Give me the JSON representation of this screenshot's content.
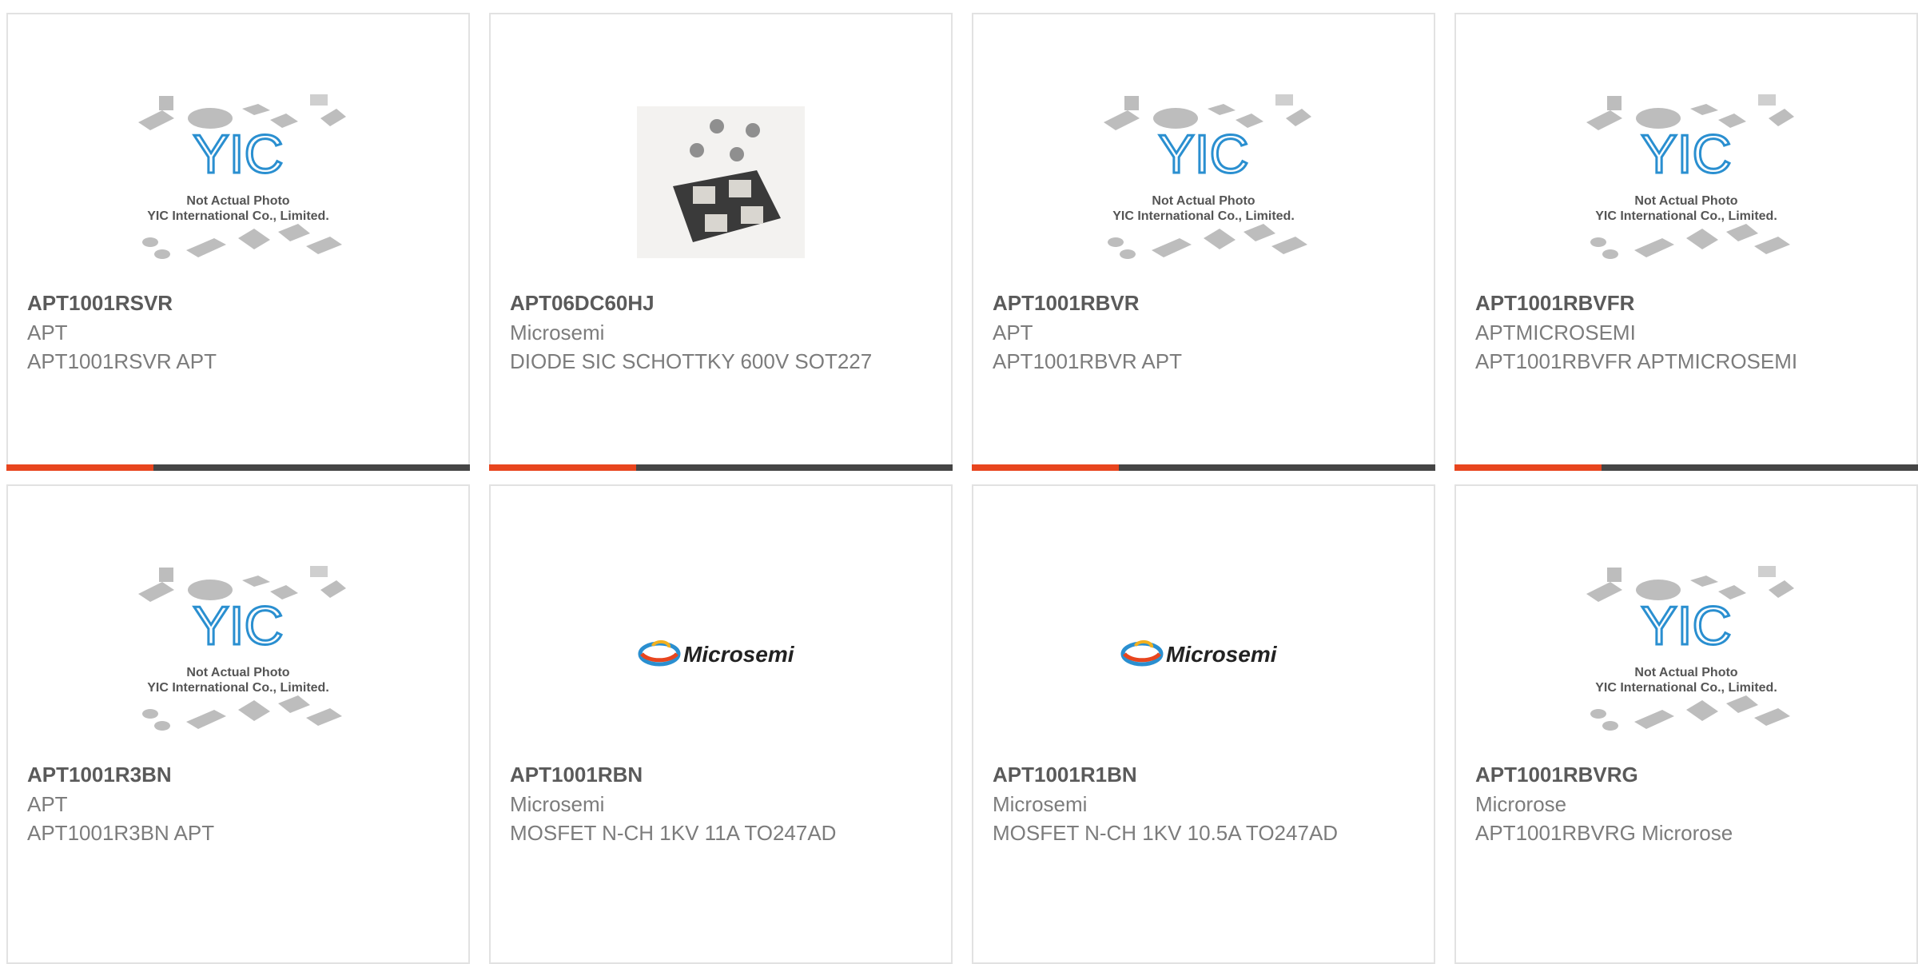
{
  "products": [
    {
      "part": "APT1001RSVR",
      "manufacturer": "APT",
      "description": "APT1001RSVR APT",
      "image": "yic-placeholder"
    },
    {
      "part": "APT06DC60HJ",
      "manufacturer": "Microsemi",
      "description": "DIODE SIC SCHOTTKY 600V SOT227",
      "image": "module-photo"
    },
    {
      "part": "APT1001RBVR",
      "manufacturer": "APT",
      "description": "APT1001RBVR APT",
      "image": "yic-placeholder"
    },
    {
      "part": "APT1001RBVFR",
      "manufacturer": "APTMICROSEMI",
      "description": "APT1001RBVFR APTMICROSEMI",
      "image": "yic-placeholder"
    },
    {
      "part": "APT1001R3BN",
      "manufacturer": "APT",
      "description": "APT1001R3BN APT",
      "image": "yic-placeholder"
    },
    {
      "part": "APT1001RBN",
      "manufacturer": "Microsemi",
      "description": "MOSFET N-CH 1KV 11A TO247AD",
      "image": "microsemi-logo"
    },
    {
      "part": "APT1001R1BN",
      "manufacturer": "Microsemi",
      "description": "MOSFET N-CH 1KV 10.5A TO247AD",
      "image": "microsemi-logo"
    },
    {
      "part": "APT1001RBVRG",
      "manufacturer": "Microrose",
      "description": "APT1001RBVRG Microrose",
      "image": "yic-placeholder"
    }
  ],
  "placeholder": {
    "logo": "YIC",
    "line1": "Not Actual Photo",
    "line2": "YIC International Co., Limited."
  },
  "brand_logo_text": "Microsemi",
  "colors": {
    "accent": "#e8451e",
    "bar": "#454545",
    "border": "#e2e2e2",
    "logo_blue": "#2a8fd0"
  }
}
